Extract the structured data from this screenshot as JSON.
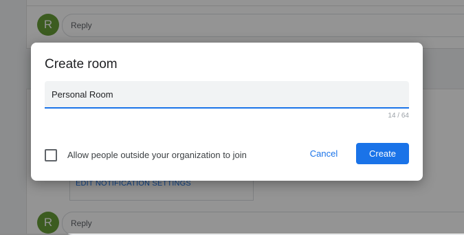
{
  "background": {
    "reply_top": {
      "avatar_letter": "R",
      "label": "Reply"
    },
    "notification_link": "EDIT NOTIFICATION SETTINGS",
    "reply_bottom": {
      "avatar_letter": "R",
      "label": "Reply"
    }
  },
  "dialog": {
    "title": "Create room",
    "name_field": {
      "value": "Personal Room",
      "char_count": "14 / 64"
    },
    "external_checkbox": {
      "checked": false,
      "label": "Allow people outside your organization to join"
    },
    "cancel_label": "Cancel",
    "create_label": "Create"
  },
  "colors": {
    "accent": "#1a73e8",
    "avatar": "#689f38",
    "title_text": "#202124"
  }
}
